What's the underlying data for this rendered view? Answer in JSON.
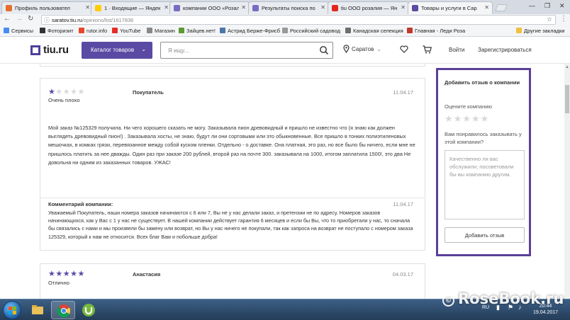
{
  "browser": {
    "tabs": [
      {
        "title": "Профиль пользовател",
        "color": "#e36f2c"
      },
      {
        "title": "1 · Входящие — Яндек",
        "color": "#ffcc00"
      },
      {
        "title": "компании ООО «Розал",
        "color": "#7b6ac2"
      },
      {
        "title": "Результаты поиска по",
        "color": "#7b6ac2"
      },
      {
        "title": "tiu ООО розалия — Ян",
        "color": "#e2261c"
      },
      {
        "title": "Товары и услуги в Сар",
        "color": "#5a4aa3"
      }
    ],
    "url_host": "saratov.tiu.ru",
    "url_path": "/opinions/list/1617836",
    "bookmarks": [
      {
        "label": "Сервисы",
        "color": "#4a8af4"
      },
      {
        "label": "Фоторизит",
        "color": "#333333"
      },
      {
        "label": "rutor.info",
        "color": "#e8462c"
      },
      {
        "label": "YouTube",
        "color": "#e52d27"
      },
      {
        "label": "Магазин",
        "color": "#888888"
      },
      {
        "label": "Зайцев.нет!",
        "color": "#5a9a2f"
      },
      {
        "label": "Астрид Берже-Фрисб",
        "color": "#4a76a8"
      },
      {
        "label": "Российский садовод",
        "color": "#999999"
      },
      {
        "label": "Канадская селекция",
        "color": "#6d6d6d"
      },
      {
        "label": "Главная - Леди Роза",
        "color": "#c0392b"
      }
    ],
    "other_bookmarks": "Другие закладки"
  },
  "header": {
    "logo": "tiu.ru",
    "catalog_button": "Каталог товаров",
    "search_placeholder": "Я ищу...",
    "city": "Саратов",
    "login": "Войти",
    "register": "Зарегистрироваться"
  },
  "reviews": [
    {
      "rating": 1,
      "rating_label": "Очень плохо",
      "author": "Покупатель",
      "date": "11.04.17",
      "text": "Мой заказ №125329 получила. Ни чего хорошего сказать не могу. Заказывала пион древовидный и пришло не известно что (я знаю как должен выглядеть древовидный пион!) . Заказывала хосты, не знаю, будут ли они сортовыми или это обыкновенные. Все пришло в тонких полиэтиленовых мешочках, в комках грязи, перевязанное между собой куском пленки. Отдельно - о доставке. Она платная, это раз, но все было бы ничего, если мне не пришлось платить за нее дважды. Один раз при заказе 200 рублей, второй раз на почте 300. заказывала на 1000, итогом заплатила 1500!, это два Не довольна ни одним из заказанных товаров. УЖАС!",
      "reply_title": "Комментарий компании:",
      "reply_date": "11.04.17",
      "reply_text": "Уважаемый Покупатель, наши номера заказов начинаются с 6 или 7, Вы не у нас делали заказ, и претензии не по адресу. Номеров заказов начинающихся, как у Вас с 1 у нас не существует. В нашей компании действует гарантия 6 месяцев и если бы Вы, что то приобретали у нас, то сначала бы связались с нами и мы произвели бы замену или возврат, но Вы у нас ничего не покупали, так как запроса на возврат не поступало с номером заказа 125329, который к нам не относится. Всех благ Вам и побольше добра!"
    },
    {
      "rating": 5,
      "rating_label": "Отлично",
      "author": "Анастасия",
      "date": "04.03.17"
    }
  ],
  "sidebar": {
    "title": "Добавить отзыв о компании",
    "rate_label": "Оцените компанию",
    "question": "Вам понравилось заказывать у этой компании?",
    "textarea_placeholder": "Качественно ли вас обслужили; посоветовали бы вы компанию другим.",
    "submit": "Добавить отзыв"
  },
  "watermark": "RoseBook.ru",
  "taskbar": {
    "lang": "RU",
    "time": "20:44",
    "date": "19.04.2017"
  },
  "colors": {
    "brand": "#5a4aa3",
    "star_on": "#5a4aa3",
    "star_off": "#d8d8d8"
  }
}
